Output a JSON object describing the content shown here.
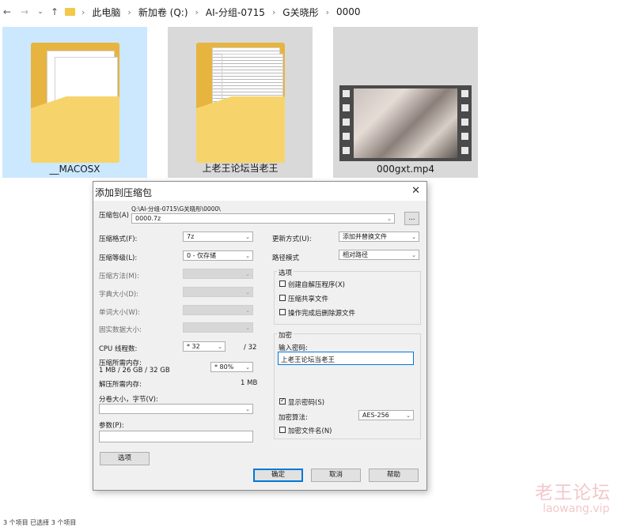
{
  "breadcrumb": {
    "items": [
      "此电脑",
      "新加卷 (Q:)",
      "AI-分组-0715",
      "G关晓彤",
      "0000"
    ]
  },
  "files": [
    {
      "name": "__MACOSX",
      "icon": "folder-icon"
    },
    {
      "name": "上老王论坛当老王",
      "icon": "folder-icon"
    },
    {
      "name": "000gxt.mp4",
      "icon": "video-thumbnail"
    }
  ],
  "dialog": {
    "title": "添加到压缩包",
    "archive_label": "压缩包(A)",
    "archive_path": "Q:\\AI-分组-0715\\G关晓彤\\0000\\",
    "archive_name": "0000.7z",
    "browse_label": "...",
    "format_label": "压缩格式(F):",
    "format_value": "7z",
    "level_label": "压缩等级(L):",
    "level_value": "0 - 仅存储",
    "method_label": "压缩方法(M):",
    "dict_label": "字典大小(D):",
    "word_label": "单词大小(W):",
    "solid_label": "固实数据大小:",
    "cpu_label": "CPU 线程数:",
    "cpu_value": "* 32",
    "cpu_max": "/ 32",
    "mem_label": "压缩所需内存:",
    "mem_detail": "1 MB / 26 GB / 32 GB",
    "mem_value": "* 80%",
    "decomp_label": "解压所需内存:",
    "decomp_value": "1 MB",
    "split_label": "分卷大小，字节(V):",
    "param_label": "参数(P):",
    "options_button": "选项",
    "update_label": "更新方式(U):",
    "update_value": "添加并替换文件",
    "path_label": "路径模式",
    "path_value": "相对路径",
    "options_group": "选项",
    "opt_sfx": "创建自解压程序(X)",
    "opt_shared": "压缩共享文件",
    "opt_delete": "操作完成后删除源文件",
    "encrypt_group": "加密",
    "password_label": "输入密码:",
    "password_value": "上老王论坛当老王",
    "show_password": "显示密码(S)",
    "encrypt_method_label": "加密算法:",
    "encrypt_method_value": "AES-256",
    "encrypt_names": "加密文件名(N)",
    "ok": "确定",
    "cancel": "取消",
    "help": "帮助"
  },
  "status_bar": "3 个项目    已选择 3 个项目",
  "watermark": {
    "line1": "老王论坛",
    "line2": "laowang.vip"
  }
}
